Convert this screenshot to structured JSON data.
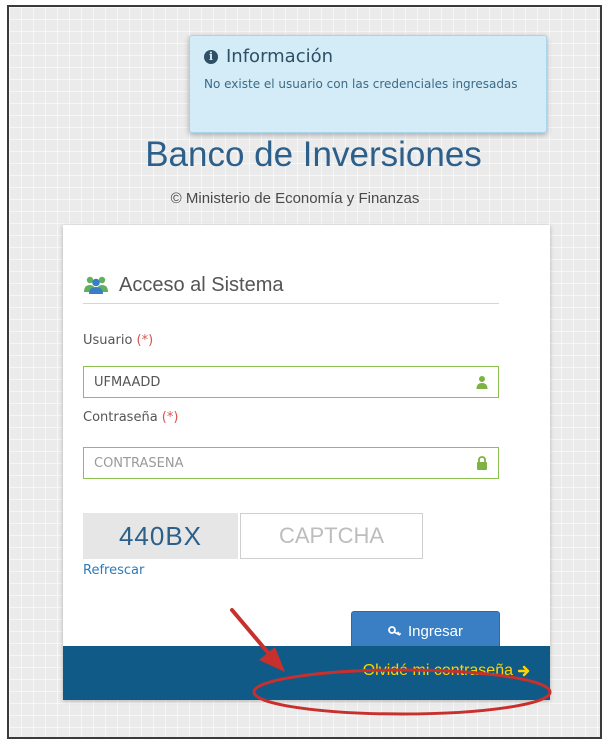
{
  "alert": {
    "title": "Información",
    "message": "No existe el usuario con las credenciales ingresadas",
    "icon": "info-circle-icon"
  },
  "header": {
    "title": "Banco de Inversiones",
    "subtitle": "© Ministerio de Economía y Finanzas"
  },
  "login": {
    "heading": "Acceso al Sistema",
    "heading_icon": "users-icon",
    "user_label": "Usuario",
    "password_label": "Contraseña",
    "required_mark": "(*)",
    "user_value": "UFMAADD",
    "password_placeholder": "CONTRASEÑA",
    "user_icon": "user-icon",
    "password_icon": "lock-icon",
    "captcha_code": "440BX",
    "captcha_placeholder": "CAPTCHA",
    "refresh_label": "Refrescar",
    "submit_label": "Ingresar",
    "submit_icon": "key-icon"
  },
  "footer": {
    "forgot_label": "Olvidé mi contraseña",
    "forgot_icon": "arrow-right-icon"
  },
  "colors": {
    "brand": "#2c5f8a",
    "footer_bg": "#0f5a86",
    "forgot_link": "#ffd400",
    "input_border": "#8cc152",
    "button": "#3a7fc3",
    "alert_bg": "#d4ecf7",
    "annotation": "#c8302e"
  }
}
